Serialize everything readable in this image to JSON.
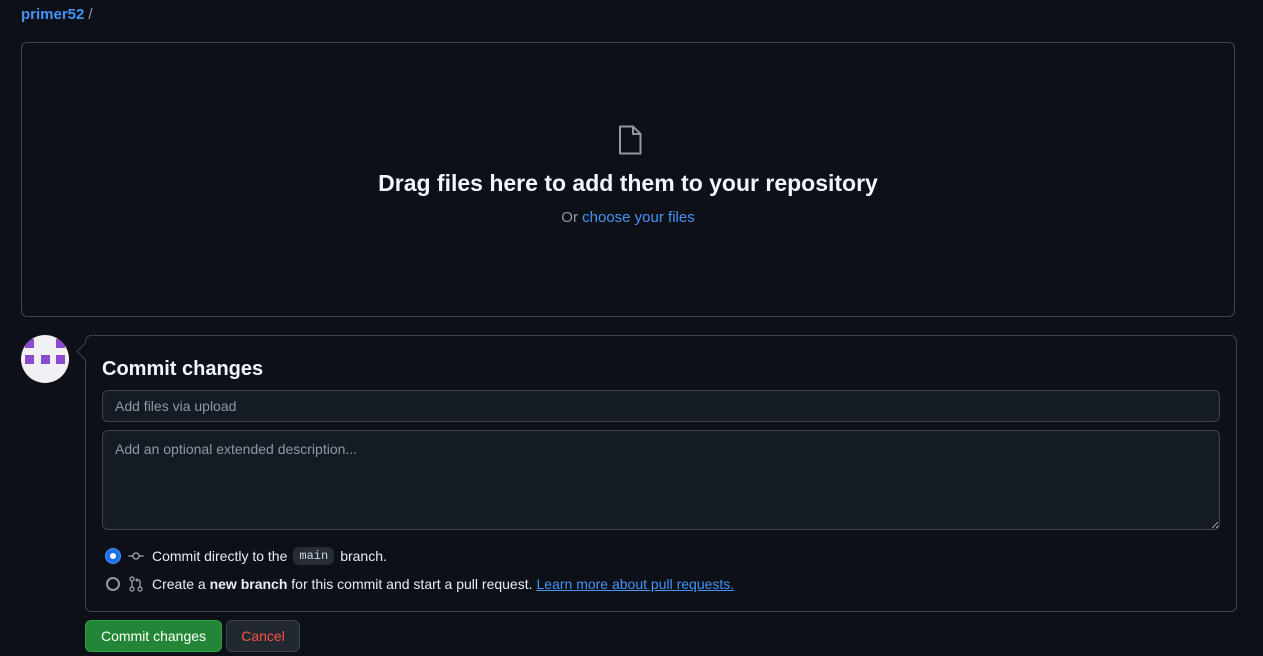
{
  "breadcrumb": {
    "repo": "primer52",
    "separator": "/"
  },
  "dropzone": {
    "icon": "file-icon",
    "title": "Drag files here to add them to your repository",
    "prefix": "Or",
    "link": "choose your files"
  },
  "commit": {
    "title": "Commit changes",
    "summary_placeholder": "Add files via upload",
    "summary_value": "",
    "description_placeholder": "Add an optional extended description...",
    "option_direct": {
      "prefix": "Commit directly to the",
      "branch": "main",
      "suffix": "branch.",
      "selected": true,
      "icon": "git-commit-icon"
    },
    "option_branch": {
      "prefix": "Create a",
      "bold": "new branch",
      "suffix": "for this commit and start a pull request.",
      "link": "Learn more about pull requests.",
      "selected": false,
      "icon": "git-pull-request-icon"
    }
  },
  "buttons": {
    "commit": "Commit changes",
    "cancel": "Cancel"
  },
  "colors": {
    "background": "#0d1117",
    "link": "#4493f8",
    "primary_button": "#238636",
    "danger_text": "#f85149",
    "avatar_accent": "#8a4bcf"
  }
}
